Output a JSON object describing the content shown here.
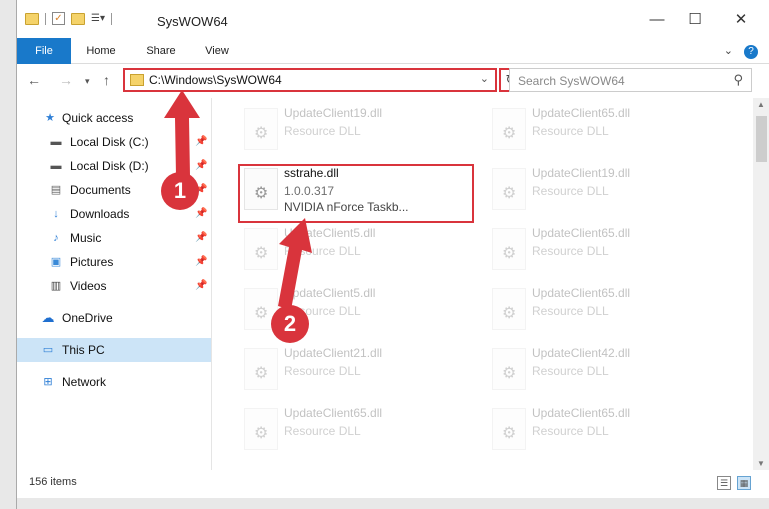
{
  "window": {
    "title": "SysWOW64"
  },
  "colors": {
    "accent": "#1979ca",
    "annotation": "#d9343c",
    "selected": "#cce4f7"
  },
  "ribbon": {
    "tabs": [
      "File",
      "Home",
      "Share",
      "View"
    ]
  },
  "address": {
    "path": "C:\\Windows\\SysWOW64"
  },
  "search": {
    "placeholder": "Search SysWOW64"
  },
  "sidebar": {
    "items": [
      {
        "label": "Quick access",
        "icon": "star-icon",
        "pinned": false
      },
      {
        "label": "Local Disk (C:)",
        "icon": "drive-icon",
        "pinned": true
      },
      {
        "label": "Local Disk (D:)",
        "icon": "drive-icon",
        "pinned": true
      },
      {
        "label": "Documents",
        "icon": "document-icon",
        "pinned": true
      },
      {
        "label": "Downloads",
        "icon": "download-icon",
        "pinned": true
      },
      {
        "label": "Music",
        "icon": "music-icon",
        "pinned": true
      },
      {
        "label": "Pictures",
        "icon": "picture-icon",
        "pinned": true
      },
      {
        "label": "Videos",
        "icon": "video-icon",
        "pinned": true
      },
      {
        "label": "OneDrive",
        "icon": "cloud-icon",
        "pinned": false
      },
      {
        "label": "This PC",
        "icon": "computer-icon",
        "pinned": false,
        "selected": true
      },
      {
        "label": "Network",
        "icon": "network-icon",
        "pinned": false
      }
    ]
  },
  "files": {
    "left": [
      {
        "name": "UpdateClient19.dll",
        "type": "Resource DLL"
      },
      {
        "name": "sstrahe.dll",
        "version": "1.0.0.317",
        "description": "NVIDIA nForce Taskb..."
      },
      {
        "name": "UpdateClient5.dll",
        "type": "Resource DLL"
      },
      {
        "name": "UpdateClient5.dll",
        "type": "Resource DLL"
      },
      {
        "name": "UpdateClient21.dll",
        "type": "Resource DLL"
      },
      {
        "name": "UpdateClient65.dll",
        "type": "Resource DLL"
      }
    ],
    "right": [
      {
        "name": "UpdateClient65.dll",
        "type": "Resource DLL"
      },
      {
        "name": "UpdateClient19.dll",
        "type": "Resource DLL"
      },
      {
        "name": "UpdateClient65.dll",
        "type": "Resource DLL"
      },
      {
        "name": "UpdateClient65.dll",
        "type": "Resource DLL"
      },
      {
        "name": "UpdateClient42.dll",
        "type": "Resource DLL"
      },
      {
        "name": "UpdateClient65.dll",
        "type": "Resource DLL"
      }
    ]
  },
  "status": {
    "count": "156 items"
  },
  "annotations": {
    "step1": "1",
    "step2": "2"
  }
}
